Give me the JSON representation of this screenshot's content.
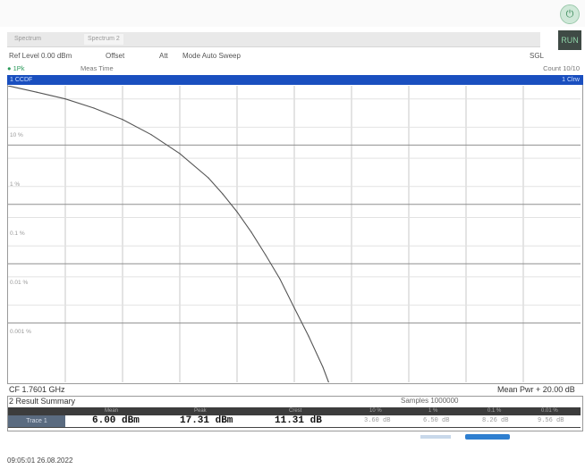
{
  "header": {
    "tabs": [
      "Spectrum",
      "Spectrum 2"
    ],
    "settings": [
      "Ref Level 0.00 dBm",
      "Offset",
      "Att",
      "Mode Auto Sweep",
      "SGL"
    ],
    "meas_left": "● 1Pk",
    "meas_info": "Meas Time",
    "count": "Count 10/10",
    "icon": "power-icon",
    "run_button": "RUN"
  },
  "diagram": {
    "title": "1 CCDF",
    "title_right": "1 Clrw",
    "y_labels": [
      "10 %",
      "1 %",
      "0.1 %",
      "0.01 %",
      "0.001 %"
    ],
    "center_freq": "CF 1.7601 GHz",
    "mean_pwr": "Mean Pwr + 20.00 dB"
  },
  "result_summary": {
    "title": "2 Result Summary",
    "samples": "Samples 1000000",
    "headers": [
      "Mean",
      "Peak",
      "Crest",
      "10 %",
      "1 %",
      "0.1 %",
      "0.01 %"
    ],
    "trace": "Trace 1",
    "mean": "6.00 dBm",
    "peak": "17.31 dBm",
    "crest": "11.31 dB",
    "p10": "3.60 dB",
    "p1": "6.50 dB",
    "p01": "8.26 dB",
    "p001": "9.56 dB"
  },
  "status": {
    "timestamp": "09:05:01  26.08.2022"
  },
  "chart_data": {
    "type": "line",
    "title": "1 CCDF",
    "xlabel": "",
    "ylabel": "",
    "y_scale": "log",
    "ylim": [
      0.001,
      100
    ],
    "xlim": [
      0,
      20
    ],
    "y_tick_labels": [
      "10 %",
      "1 %",
      "0.1 %",
      "0.01 %",
      "0.001 %"
    ],
    "grid": true,
    "series": [
      {
        "values_x": [
          0,
          1,
          2,
          3,
          4,
          5,
          6,
          7,
          7.5,
          8,
          8.5,
          9,
          9.5,
          10,
          10.5,
          11,
          11.2
        ],
        "values_y": [
          100,
          78,
          60,
          42,
          27,
          15,
          7.2,
          2.8,
          1.5,
          0.75,
          0.34,
          0.14,
          0.055,
          0.018,
          0.006,
          0.0018,
          0.001
        ]
      }
    ],
    "colors": {
      "trace": "#555555",
      "grid": "#c9c9c9"
    }
  }
}
